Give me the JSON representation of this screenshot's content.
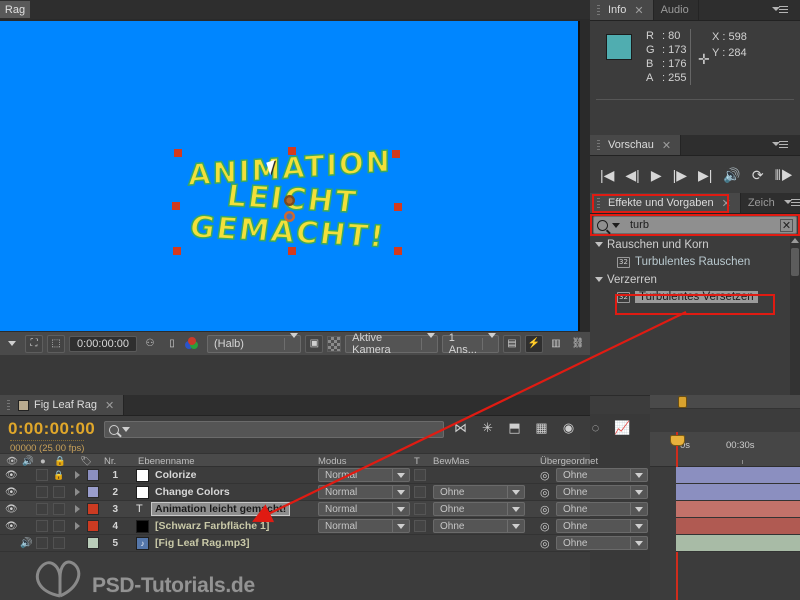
{
  "window": {
    "stub_tab": "Rag"
  },
  "info_panel": {
    "tabs": [
      {
        "label": "Info",
        "active": true,
        "closable": true
      },
      {
        "label": "Audio",
        "active": false,
        "closable": false
      }
    ],
    "swatch_color": "#50adb0",
    "channels": [
      {
        "key": "R",
        "value": "80"
      },
      {
        "key": "G",
        "value": "173"
      },
      {
        "key": "B",
        "value": "176"
      },
      {
        "key": "A",
        "value": "255"
      }
    ],
    "x_label": "X : 598",
    "y_label": "Y : 284"
  },
  "preview_panel": {
    "tab": "Vorschau",
    "buttons": [
      "first-frame",
      "prev-frame",
      "play",
      "next-frame",
      "last-frame",
      "audio",
      "loop",
      "ram-preview"
    ]
  },
  "effects_panel": {
    "tab": "Effekte und Vorgaben",
    "secondary_tab": "Zeich",
    "search_value": "turb",
    "highlight_color": "#e01b12",
    "groups": [
      {
        "name": "Rauschen und Korn",
        "items": [
          {
            "label": "Turbulentes Rauschen",
            "badge": "32",
            "selected": false
          }
        ]
      },
      {
        "name": "Verzerren",
        "items": [
          {
            "label": "Turbulentes Versetzen",
            "badge": "32",
            "selected": true
          }
        ]
      }
    ]
  },
  "composition": {
    "background_color": "#0086ff",
    "text_line1": "ANIMATION",
    "text_line2": "LEICHT GEMACHT!",
    "text_color": "#f2e03a",
    "handle_color": "#d43a1e",
    "toolbar": {
      "timecode": "0:00:00:00",
      "resolution": "(Halb)",
      "camera": "Aktive Kamera",
      "views": "1 Ans...",
      "icons": [
        "select-dropdown",
        "fit-icon",
        "region-of-interest-icon",
        "snapshot-icon",
        "show-snapshot-icon",
        "channel-icon",
        "mask-icon",
        "transparency-grid-icon",
        "title-safe-icon",
        "fast-preview-icon",
        "timeline-icon",
        "comp-flowchart-icon"
      ]
    }
  },
  "timeline": {
    "tab": "Fig Leaf Rag",
    "timecode": "0:00:00:00",
    "frame_info": "00000 (25.00 fps)",
    "search_placeholder": "",
    "toolbar_icons": [
      "shy-icon",
      "collapse-transform-icon",
      "draft-3d-icon",
      "frame-blend-icon",
      "motion-blur-icon",
      "brainstorm-icon",
      "graph-editor-icon"
    ],
    "columns": [
      "Nr.",
      "Ebenenname",
      "Modus",
      "T",
      "BewMas",
      "Übergeordnet"
    ],
    "ruler_labels": [
      "0s",
      "00:30s"
    ],
    "layers": [
      {
        "num": "1",
        "name": "Colorize",
        "name_style": "plain",
        "visible": true,
        "audio": false,
        "locked": true,
        "color": "#8b8fc0",
        "icon_color": "#ffffff",
        "mode": "Normal",
        "track_matte": "",
        "parent": "Ohne",
        "bar_color": "#8b8fc0",
        "selected": false
      },
      {
        "num": "2",
        "name": "Change Colors",
        "name_style": "plain",
        "visible": true,
        "audio": false,
        "locked": false,
        "color": "#9a9ecd",
        "icon_color": "#ffffff",
        "mode": "Normal",
        "track_matte": "Ohne",
        "parent": "Ohne",
        "bar_color": "#8b8fc0",
        "selected": false
      },
      {
        "num": "3",
        "name": "Animation leicht gemacht!",
        "name_style": "selected",
        "visible": true,
        "audio": false,
        "locked": false,
        "color": "#cc3b22",
        "icon_color": "#303030",
        "mode": "Normal",
        "track_matte": "Ohne",
        "parent": "Ohne",
        "bar_color": "#c2726a",
        "selected": true
      },
      {
        "num": "4",
        "name": "[Schwarz Farbfläche 1]",
        "name_style": "bracket",
        "visible": true,
        "audio": false,
        "locked": false,
        "color": "#cc3b22",
        "icon_color": "#000000",
        "mode": "Normal",
        "track_matte": "Ohne",
        "parent": "Ohne",
        "bar_color": "#b05a52",
        "selected": false
      },
      {
        "num": "5",
        "name": "[Fig Leaf Rag.mp3]",
        "name_style": "bracket",
        "visible": false,
        "audio": true,
        "locked": false,
        "color": "#b9ccb9",
        "icon_color": "#5577aa",
        "mode": "",
        "track_matte": "",
        "parent": "Ohne",
        "bar_color": "#a8bba6",
        "selected": false
      }
    ]
  },
  "watermark": {
    "text": "PSD-Tutorials.de"
  }
}
